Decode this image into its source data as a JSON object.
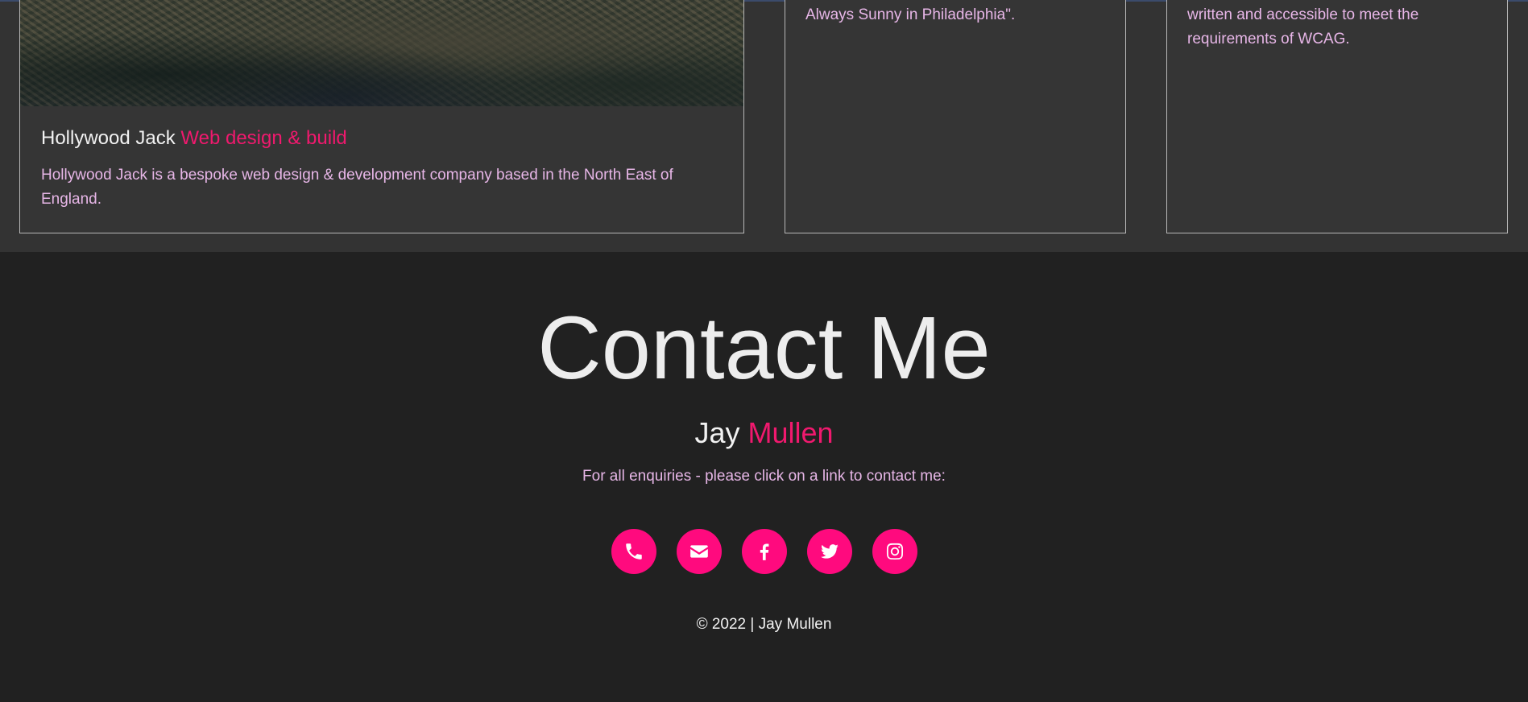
{
  "projects": [
    {
      "title": "Hollywood Jack",
      "subtitle": "Web design & build",
      "description": "Hollywood Jack is a bespoke web design & development company based in the North East of England."
    },
    {
      "description_tail": "Always Sunny in Philadelphia\"."
    },
    {
      "description_tail": "written and accessible to meet the requirements of WCAG."
    }
  ],
  "contact": {
    "heading": "Contact Me",
    "first_name": "Jay",
    "last_name": "Mullen",
    "intro": "For all enquiries - please click on a link to contact me:",
    "links": [
      {
        "icon": "phone-icon"
      },
      {
        "icon": "envelope-icon"
      },
      {
        "icon": "facebook-icon"
      },
      {
        "icon": "twitter-icon"
      },
      {
        "icon": "instagram-icon"
      }
    ],
    "copyright": "© 2022 | Jay Mullen"
  },
  "colors": {
    "accent": "#f0196e",
    "social_button": "#ff0a7e",
    "body_text": "#e7b6e7",
    "card_bg": "#353535",
    "footer_bg": "#212121"
  }
}
